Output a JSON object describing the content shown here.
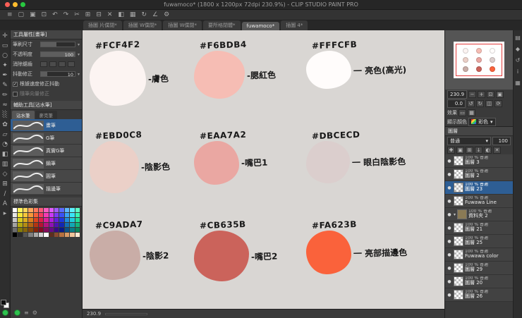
{
  "window": {
    "title": "fuwamoco* (1800 x 1200px 72dpi 230.9%) - CLIP STUDIO PAINT PRO"
  },
  "menubar_icons": [
    {
      "icon": "menu-icon",
      "glyph": "≡"
    },
    {
      "icon": "new-file-icon",
      "glyph": "▢"
    },
    {
      "icon": "open-file-icon",
      "glyph": "▣"
    },
    {
      "icon": "save-icon",
      "glyph": "⊡"
    },
    {
      "icon": "undo-icon",
      "glyph": "↶"
    },
    {
      "icon": "redo-icon",
      "glyph": "↷"
    },
    {
      "icon": "cut-icon",
      "glyph": "✂"
    },
    {
      "icon": "copy-icon",
      "glyph": "⊞"
    },
    {
      "icon": "paste-icon",
      "glyph": "⊟"
    },
    {
      "icon": "delete-icon",
      "glyph": "✕"
    },
    {
      "icon": "fill-icon",
      "glyph": "◧"
    },
    {
      "icon": "grid-icon",
      "glyph": "▦"
    },
    {
      "icon": "rotate-view-icon",
      "glyph": "↻"
    },
    {
      "icon": "snap-icon",
      "glyph": "∠"
    },
    {
      "icon": "settings-icon",
      "glyph": "⚙"
    }
  ],
  "tabs": [
    {
      "label": "插圖 片僕閉*"
    },
    {
      "label": "插圖 W僕閉*"
    },
    {
      "label": "插圖 W僕閉*"
    },
    {
      "label": "要所格閉體*"
    },
    {
      "label": "fuwamoco*",
      "active": true
    },
    {
      "label": "插圖 4*"
    }
  ],
  "tool_strip": [
    {
      "icon": "move-tool",
      "glyph": "✛"
    },
    {
      "icon": "marquee-tool",
      "glyph": "▭"
    },
    {
      "icon": "lasso-tool",
      "glyph": "○"
    },
    {
      "icon": "magic-wand-tool",
      "glyph": "✦"
    },
    {
      "icon": "eyedropper-tool",
      "glyph": "✒"
    },
    {
      "icon": "pen-tool",
      "glyph": "✎"
    },
    {
      "icon": "pencil-tool",
      "glyph": "✏"
    },
    {
      "icon": "brush-tool",
      "glyph": "≈"
    },
    {
      "icon": "airbrush-tool",
      "glyph": "░"
    },
    {
      "icon": "decoration-tool",
      "glyph": "✿"
    },
    {
      "icon": "eraser-tool",
      "glyph": "▱"
    },
    {
      "icon": "blend-tool",
      "glyph": "◔"
    },
    {
      "icon": "fill-tool",
      "glyph": "◧"
    },
    {
      "icon": "gradient-tool",
      "glyph": "▥"
    },
    {
      "icon": "shape-tool",
      "glyph": "◇"
    },
    {
      "icon": "frame-tool",
      "glyph": "⊞"
    },
    {
      "icon": "ruler-tool",
      "glyph": "∕"
    },
    {
      "icon": "text-tool",
      "glyph": "A"
    },
    {
      "icon": "operation-tool",
      "glyph": "▸"
    }
  ],
  "tool_properties": {
    "title": "工具屬性[畫筆]",
    "brush_size_label": "筆刷尺寸",
    "opacity_label": "不透明度",
    "opacity_value": "100",
    "antialias_label": "消除鋸齒",
    "stabilize_label": "抖動修正",
    "stabilize_value": "10",
    "speed_check_label": "根據速度修正抖動",
    "post_check_label": "隨筆向量修正"
  },
  "sub_tool": {
    "title": "輔助工具[沾水筆]",
    "tabs": [
      {
        "label": "沾水筆",
        "active": true
      },
      {
        "label": "麥克筆"
      }
    ],
    "brushes": [
      {
        "label": "畫筆",
        "selected": true
      },
      {
        "label": "G筆"
      },
      {
        "label": "真實G筆"
      },
      {
        "label": "鏑筆"
      },
      {
        "label": "圓筆"
      },
      {
        "label": "描邊筆"
      }
    ]
  },
  "color_palette": {
    "title": "標準色彩集",
    "colors": [
      "#FFFFFF",
      "#FFF45C",
      "#FFD85C",
      "#FFA85C",
      "#FF7A5C",
      "#FF5C7A",
      "#FF5CC0",
      "#E05CFF",
      "#A05CFF",
      "#5C6BFF",
      "#5CB8FF",
      "#5CF0FF",
      "#5CFFC4",
      "#E8E8E8",
      "#F5E93A",
      "#F7C83A",
      "#F7973A",
      "#F7613A",
      "#F73A61",
      "#F73AB4",
      "#C93AF7",
      "#7A3AF7",
      "#3A52F7",
      "#3AA5F7",
      "#3AE5F7",
      "#3AF7B0",
      "#C9C9C9",
      "#D9CC1F",
      "#DCAE1F",
      "#DC7E1F",
      "#DC451F",
      "#DC1F45",
      "#DC1F9A",
      "#AE1FDC",
      "#611FDC",
      "#1F38DC",
      "#1F8CDC",
      "#1FCCDC",
      "#1FDC97",
      "#A3A3A3",
      "#B3A812",
      "#B58D12",
      "#B56312",
      "#B53412",
      "#B51234",
      "#B5127E",
      "#8D12B5",
      "#4C12B5",
      "#1228B5",
      "#1270B5",
      "#12A8B5",
      "#12B57B",
      "#6E6E6E",
      "#847B0A",
      "#86660A",
      "#86470A",
      "#86230A",
      "#860A23",
      "#860A5C",
      "#660A86",
      "#360A86",
      "#0A1B86",
      "#0A5186",
      "#0A7C86",
      "#0A8659",
      "#000000",
      "#2B2B2B",
      "#555555",
      "#808080",
      "#AAAAAA",
      "#D4D4D4",
      "#FFFFFF",
      "#5C2E1E",
      "#8A4A2E",
      "#B5703F",
      "#D99B66",
      "#F0C49A",
      "#FFE9D2"
    ]
  },
  "canvas": {
    "status_zoom": "230.9",
    "swatches": [
      {
        "hex": "#FCF4F2",
        "label": "-膚色"
      },
      {
        "hex": "#F6BDB4",
        "label": "-腮紅色"
      },
      {
        "hex": "#FFFCFB",
        "label": "一 亮色(高光)"
      },
      {
        "hex": "#EBD0C8",
        "label": "-陰影色"
      },
      {
        "hex": "#EAA7A2",
        "label": "-嘴巴1"
      },
      {
        "hex": "#DBCECD",
        "label": "一 眼白陰影色"
      },
      {
        "hex": "#C9ADA7",
        "label": "-陰影2"
      },
      {
        "hex": "#CB635B",
        "label": "-嘴巴2"
      },
      {
        "hex": "#FA623B",
        "label": "一 亮部描邊色"
      }
    ]
  },
  "navigator": {
    "zoom_value": "230.9",
    "rotate_value": "0.0",
    "effect_label": "效果",
    "display_color_label": "顯示顏色",
    "display_color_value": "彩色",
    "zoom_buttons": [
      {
        "icon": "zoom-out-icon",
        "glyph": "−"
      },
      {
        "icon": "zoom-in-icon",
        "glyph": "+"
      },
      {
        "icon": "fit-screen-icon",
        "glyph": "⊡"
      },
      {
        "icon": "actual-size-icon",
        "glyph": "▣"
      }
    ],
    "rotate_buttons": [
      {
        "icon": "rotate-left-icon",
        "glyph": "↺"
      },
      {
        "icon": "rotate-right-icon",
        "glyph": "↻"
      },
      {
        "icon": "flip-horizontal-icon",
        "glyph": "◫"
      },
      {
        "icon": "reset-rotation-icon",
        "glyph": "⟳"
      }
    ]
  },
  "layers": {
    "panel_title": "圖層",
    "blend_mode": "普通",
    "opacity_value": "100",
    "action_icons": [
      {
        "icon": "new-layer-icon",
        "glyph": "✚"
      },
      {
        "icon": "new-folder-icon",
        "glyph": "▣"
      },
      {
        "icon": "duplicate-layer-icon",
        "glyph": "⊞"
      },
      {
        "icon": "merge-down-icon",
        "glyph": "↓"
      },
      {
        "icon": "layer-mask-icon",
        "glyph": "◐"
      },
      {
        "icon": "delete-layer-icon",
        "glyph": "✕"
      }
    ],
    "items": [
      {
        "meta": "100 % 普通",
        "name": "圖層 3"
      },
      {
        "meta": "100 % 普通",
        "name": "圖層 2"
      },
      {
        "meta": "100 % 普通",
        "name": "圖層 23",
        "selected": true
      },
      {
        "meta": "100 % 普通",
        "name": "Fuwawa Line"
      },
      {
        "meta": "100 % 普通",
        "name": "資料夾 2",
        "folder": true
      },
      {
        "meta": "100 % 普通",
        "name": "圖層 21"
      },
      {
        "meta": "100 % 普通",
        "name": "圖層 25"
      },
      {
        "meta": "100 % 普通",
        "name": "Fuwawa color"
      },
      {
        "meta": "100 % 普通",
        "name": "圖層 29"
      },
      {
        "meta": "100 % 普通",
        "name": "圖層 20"
      },
      {
        "meta": "100 % 普通",
        "name": "圖層 26"
      }
    ]
  },
  "right_strip": [
    {
      "icon": "quick-access-icon",
      "glyph": "▤"
    },
    {
      "icon": "material-icon",
      "glyph": "◆"
    },
    {
      "icon": "history-icon",
      "glyph": "↺"
    },
    {
      "icon": "information-icon",
      "glyph": "i"
    },
    {
      "icon": "panel-list-icon",
      "glyph": "▦"
    }
  ]
}
